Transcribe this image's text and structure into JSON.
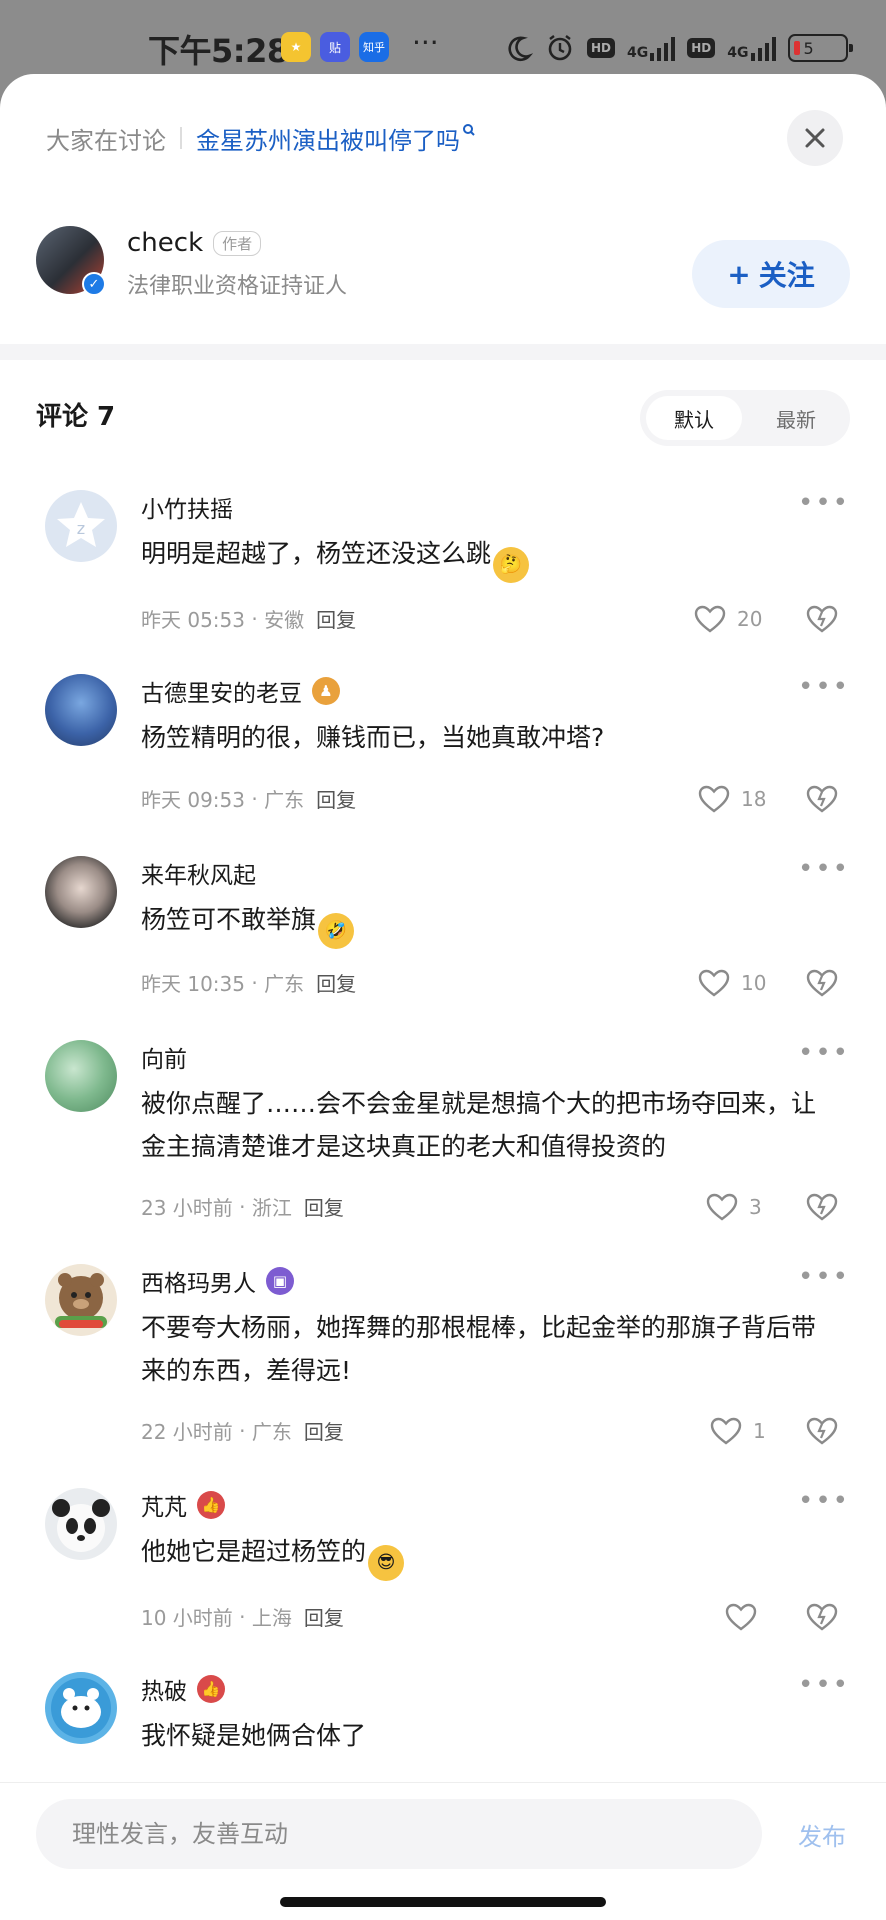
{
  "status_bar": {
    "time": "下午5:28",
    "app_icon_3": "知乎",
    "dots": "···",
    "hd1": "HD",
    "net1": "4G",
    "hd2": "HD",
    "net2": "4G",
    "battery": "5"
  },
  "header": {
    "topic_label": "大家在讨论",
    "topic_link": "金星苏州演出被叫停了吗",
    "close_icon": "close-icon"
  },
  "author": {
    "name": "check",
    "tag": "作者",
    "description": "法律职业资格证持证人",
    "follow_label": "关注",
    "follow_prefix": "+"
  },
  "comments_header": {
    "title": "评论 7",
    "sort_default": "默认",
    "sort_latest": "最新"
  },
  "comments": [
    {
      "user": "小竹扶摇",
      "text": "明明是超越了，杨笠还没这么跳",
      "time": "昨天 05:53",
      "location": "安徽",
      "reply": "回复",
      "likes": "20"
    },
    {
      "user": "古德里安的老豆",
      "text": "杨笠精明的很，赚钱而已，当她真敢冲塔?",
      "time": "昨天 09:53",
      "location": "广东",
      "reply": "回复",
      "likes": "18"
    },
    {
      "user": "来年秋风起",
      "text": "杨笠可不敢举旗",
      "time": "昨天 10:35",
      "location": "广东",
      "reply": "回复",
      "likes": "10"
    },
    {
      "user": "向前",
      "text": "被你点醒了……会不会金星就是想搞个大的把市场夺回来，让金主搞清楚谁才是这块真正的老大和值得投资的",
      "time": "23 小时前",
      "location": "浙江",
      "reply": "回复",
      "likes": "3"
    },
    {
      "user": "西格玛男人",
      "text": "不要夸大杨丽，她挥舞的那根棍棒，比起金举的那旗子背后带来的东西，差得远!",
      "time": "22 小时前",
      "location": "广东",
      "reply": "回复",
      "likes": "1"
    },
    {
      "user": "芃芃",
      "text": "他她它是超过杨笠的",
      "time": "10 小时前",
      "location": "上海",
      "reply": "回复",
      "likes": ""
    },
    {
      "user": "热破",
      "text": "我怀疑是她俩合体了"
    }
  ],
  "input": {
    "placeholder": "理性发言，友善互动",
    "publish_label": "发布"
  },
  "colors": {
    "accent": "#1b5fc4",
    "follow_bg": "#ebf2fc",
    "publish_disabled": "#9fc0ee"
  }
}
